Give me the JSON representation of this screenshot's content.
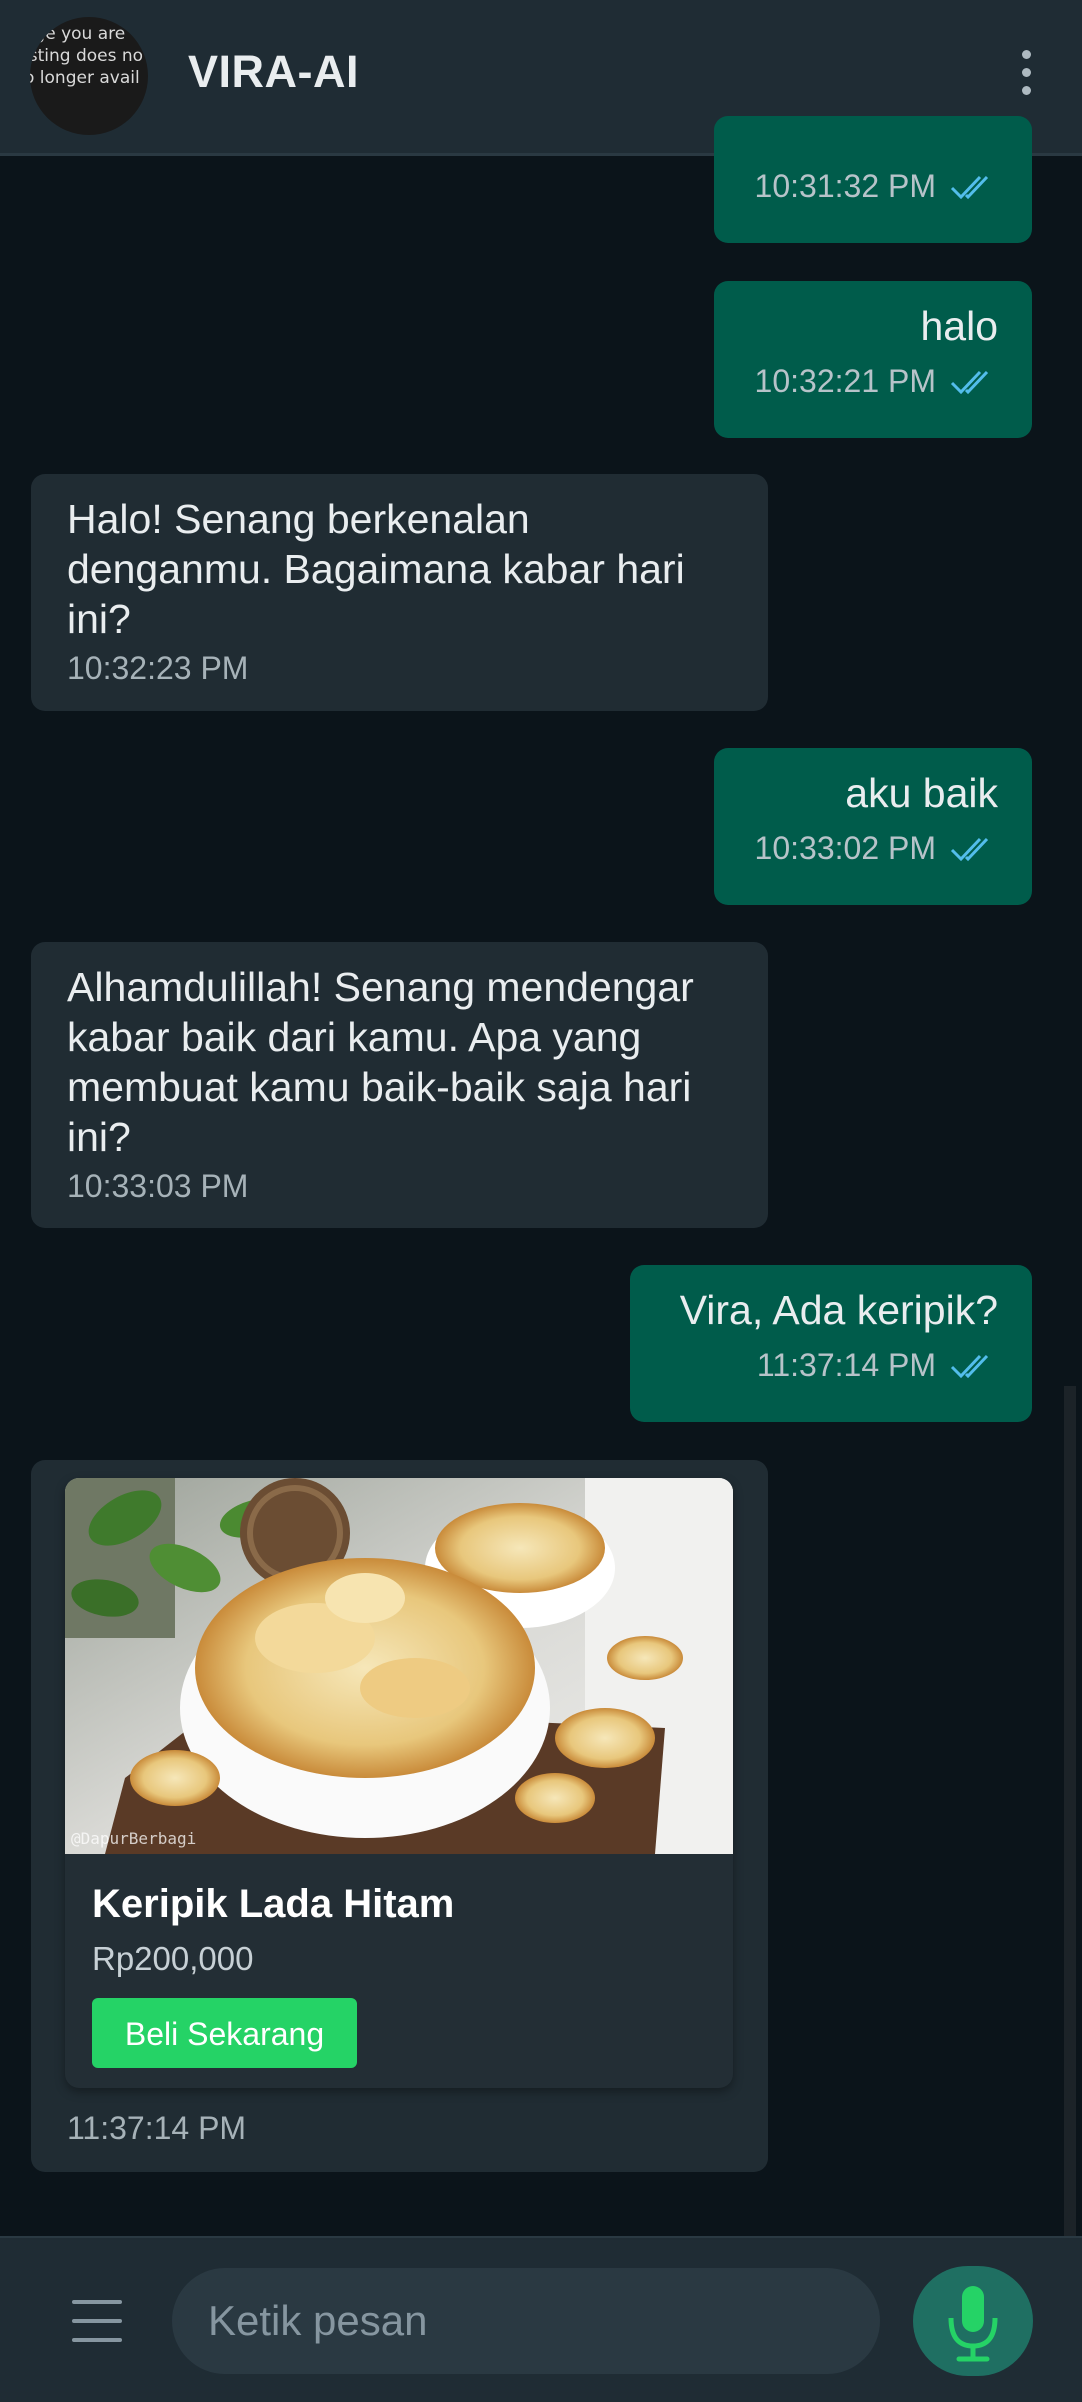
{
  "header": {
    "title": "VIRA-AI",
    "avatar_broken_text": "age you are\nisting does no\no longer avail\n\nm"
  },
  "messages": [
    {
      "direction": "out",
      "text": "",
      "time": "10:31:32 PM"
    },
    {
      "direction": "out",
      "text": "halo",
      "time": "10:32:21 PM"
    },
    {
      "direction": "in",
      "text": "Halo! Senang berkenalan denganmu. Bagaimana kabar hari ini?",
      "time": "10:32:23 PM"
    },
    {
      "direction": "out",
      "text": "aku baik",
      "time": "10:33:02 PM"
    },
    {
      "direction": "in",
      "text": "Alhamdulillah! Senang mendengar kabar baik dari kamu. Apa yang membuat kamu baik-baik saja hari ini?",
      "time": "10:33:03 PM"
    },
    {
      "direction": "out",
      "text": "Vira, Ada keripik?",
      "time": "11:37:14 PM"
    }
  ],
  "product": {
    "name": "Keripik Lada Hitam",
    "price": "Rp200,000",
    "button_label": "Beli Sekarang",
    "watermark": "@DapurBerbagi",
    "time": "11:37:14 PM"
  },
  "composer": {
    "placeholder": "Ketik pesan"
  },
  "colors": {
    "background": "#0b141a",
    "header": "#1f2c34",
    "outgoing_bubble": "#005c4b",
    "incoming_bubble": "#202c33",
    "buy_button": "#25d366",
    "read_ticks": "#53bdeb"
  },
  "icons": {
    "menu": "three-dots-vertical-icon",
    "ticks": "double-check-icon",
    "attach_menu": "hamburger-icon",
    "mic": "microphone-icon"
  }
}
